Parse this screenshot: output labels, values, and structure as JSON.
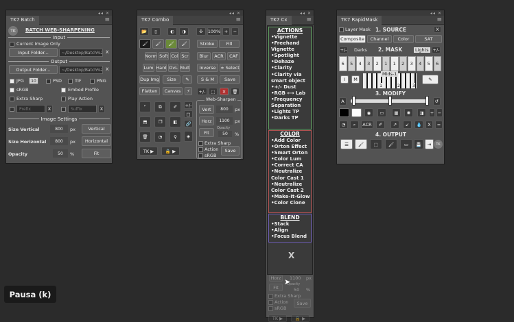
{
  "batch": {
    "tab": "TK7 Batch",
    "title": "BATCH WEB-SHARPENING",
    "input_section": "Input",
    "current_image_only": "Current Image Only",
    "input_folder_btn": "Input Folder...",
    "input_path": "~/Desktop/Batch%20",
    "x": "X",
    "output_section": "Output",
    "output_folder_btn": "Output Folder...",
    "output_path": "~/Desktop/Batch%20",
    "jpg": "JPG",
    "jpg_quality": "10",
    "psd": "PSD",
    "tif": "TIF",
    "png": "PNG",
    "srgb": "sRGB",
    "embed_profile": "Embed Profile",
    "extra_sharp": "Extra Sharp",
    "play_action": "Play Action",
    "prefix": "Prefix",
    "suffix": "Suffix",
    "image_settings_section": "Image Settings",
    "size_vertical": "Size Vertical",
    "size_vertical_val": "800",
    "size_horizontal": "Size Horizontal",
    "size_horizontal_val": "800",
    "px": "px",
    "vertical_btn": "Vertical",
    "horizontal_btn": "Horizontal",
    "opacity": "Opacity",
    "opacity_val": "50",
    "pct": "%",
    "fit_btn": "Fit"
  },
  "combo": {
    "tab": "TK7 Combo",
    "zoom": "100%",
    "norm": "Norm",
    "soft": "Soft",
    "col": "Col",
    "scr": "Scr",
    "stroke": "Stroke",
    "fill": "Fill",
    "lum": "Lum",
    "hard": "Hard",
    "ovl": "OvL",
    "mult": "Mult",
    "blur": "Blur",
    "acr": "ACR",
    "caf": "CAF",
    "inverse": "Inverse",
    "pm_select": "± Select",
    "dup_img": "Dup Img",
    "size": "Size",
    "sm": "S & M",
    "save": "Save",
    "flatten": "Flatten",
    "canvas": "Canvas",
    "plusminus": "+/-",
    "web_sharpen": "Web-Sharpen",
    "vert": "Vert",
    "vert_val": "800",
    "horz": "Horz",
    "horz_val": "1100",
    "fit": "Fit",
    "opacity_lbl": "Opacity",
    "opacity_val": "50",
    "px": "px",
    "pct": "%",
    "extra_sharp": "Extra Sharp",
    "action": "Action",
    "srgb": "sRGB",
    "save_btn": "Save",
    "tk": "TK ▶",
    "lock": "🔒 ▶"
  },
  "cx": {
    "tab": "TK7 Cx",
    "actions_head": "ACTIONS",
    "actions": [
      "•Vignette",
      "•Freehand",
      "  Vignette",
      "•Spotlight",
      "•Dehaze",
      "•Clarity",
      "•Clarity via",
      "  smart object",
      "•+/- Dust",
      "•RGB ⟷ Lab",
      "•Frequency",
      "  Separation",
      "•Lights TP",
      "•Darks TP"
    ],
    "color_head": "COLOR",
    "color": [
      "•Add Color",
      "•Orton Effect",
      "•Smart Orton",
      "•Color Lum",
      "•Correct CA",
      "•Neutralize",
      "  Color Cast 1",
      "•Neutralize",
      "  Color Cast 2",
      "•Make-It-Glow",
      "•Color Clone"
    ],
    "blend_head": "BLEND",
    "blend": [
      "•Stack",
      "•Align",
      "•Focus Blend"
    ],
    "close": "X",
    "ghost_horz": "Horz",
    "ghost_horz_val": "1100",
    "ghost_px": "px",
    "ghost_fit": "Fit",
    "ghost_opacity": "Opacity",
    "ghost_opacity_val": "50",
    "ghost_pct": "%",
    "ghost_extra": "Extra Sharp",
    "ghost_action": "Action",
    "ghost_srgb": "sRGB",
    "ghost_save": "Save",
    "ghost_tk": "TK ▶",
    "ghost_lock": "🔒 ▶"
  },
  "rapid": {
    "tab": "TK7 RapidMask",
    "layer_mask": "Layer Mask",
    "source_head": "1. SOURCE",
    "x": "X",
    "composite": "Composite",
    "channel": "Channel",
    "color": "Color",
    "sat": "SAT",
    "pm1": "+/-",
    "darks": "Darks",
    "mask_head": "2. MASK",
    "lights": "Lights",
    "pm2": "+/-",
    "left_keys": [
      "6",
      "5",
      "4",
      "3"
    ],
    "mid_keys": [
      "2",
      "1",
      "1",
      "2"
    ],
    "right_keys": [
      "3",
      "4",
      "5",
      "6"
    ],
    "i": "I",
    "m": "M",
    "mids": "Mids-1",
    "n1": "1",
    "n2": "2",
    "n3": "3",
    "modify_head": "3. MODIFY",
    "a": "A",
    "acr": "ACR",
    "x2": "X",
    "eq": "=",
    "output_head": "4. OUTPUT"
  },
  "overlay": {
    "pause": "Pausa (k)"
  }
}
